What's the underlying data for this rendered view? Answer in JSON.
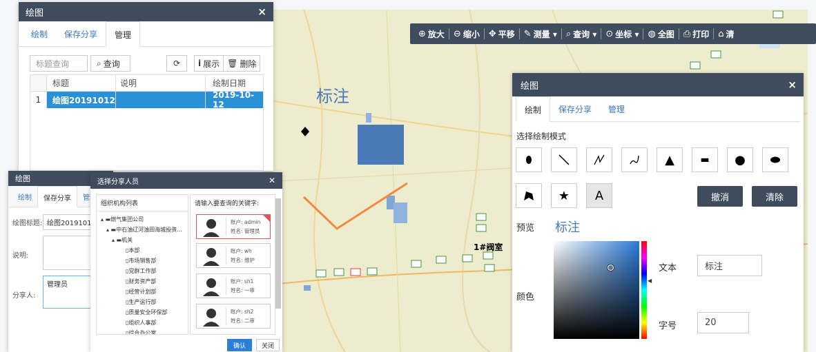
{
  "colors": {
    "header": "#3f4c5e",
    "selected_row": "#2b91d6",
    "link": "#3a77c0",
    "map_bg": "#eeeccf",
    "rect": "#4a7ab8",
    "line": "#f08a40"
  },
  "toolbar": {
    "items": [
      {
        "icon": "plus-circle-icon",
        "label": "放大"
      },
      {
        "icon": "minus-circle-icon",
        "label": "缩小"
      },
      {
        "icon": "move-icon",
        "label": "平移"
      },
      {
        "icon": "ruler-icon",
        "label": "测量 ▾"
      },
      {
        "icon": "search-box-icon",
        "label": "查询 ▾"
      },
      {
        "icon": "location-pin-icon",
        "label": "坐标 ▾"
      },
      {
        "icon": "globe-icon",
        "label": "全图"
      },
      {
        "icon": "printer-icon",
        "label": "打印"
      },
      {
        "icon": "clear-icon",
        "label": "清"
      }
    ]
  },
  "map": {
    "label_biaozhu": "标注",
    "label_famen": "1#阀室"
  },
  "left_panel": {
    "title": "绘图",
    "tabs": [
      "绘制",
      "保存分享",
      "管理"
    ],
    "search_placeholder": "标题查询",
    "query_btn": "查询",
    "show_btn": "展示",
    "delete_btn": "删除",
    "columns": [
      "标题",
      "说明",
      "绘制日期"
    ],
    "rows": [
      {
        "index": "1",
        "title": "绘图20191012",
        "desc": "",
        "date": "2019-10-12"
      }
    ]
  },
  "share_panel": {
    "title": "绘图",
    "tabs": [
      "绘制",
      "保存分享",
      "管理"
    ],
    "title_label": "绘图标题:",
    "title_value": "绘图20191012",
    "desc_label": "说明:",
    "sharer_label": "分享人:",
    "sharer_value": "管理员"
  },
  "select_modal": {
    "title": "选择分享人员",
    "org_header": "组织机构列表",
    "search_header": "请输入要查询的关键字:",
    "tree": [
      "燃气集团公司",
      "中石油辽河油田海城投资…",
      "机关",
      "本部",
      "市场销售部",
      "党群工作部",
      "财务资产部",
      "经营计划部",
      "生产运行部",
      "质量安全环保部",
      "组织人事部",
      "综合办公室"
    ],
    "users": [
      {
        "account": "账户: admin",
        "name": "姓名: 管理员",
        "selected": true
      },
      {
        "account": "账户: wh",
        "name": "姓名: 维护",
        "selected": false
      },
      {
        "account": "账户: sh1",
        "name": "姓名: 一审",
        "selected": false
      },
      {
        "account": "账户: sh2",
        "name": "姓名: 二审",
        "selected": false
      }
    ],
    "ok_btn": "确认",
    "cancel_btn": "关闭"
  },
  "draw_panel": {
    "title": "绘图",
    "tabs": [
      "绘制",
      "保存分享",
      "管理"
    ],
    "mode_label": "选择绘制模式",
    "undo_btn": "撤消",
    "clear_btn": "清除",
    "preview_label": "预览",
    "preview_text": "标注",
    "color_label": "颜色",
    "text_label": "文本",
    "text_value": "标注",
    "size_label": "字号",
    "size_value": "20",
    "text_tool_glyph": "A"
  }
}
